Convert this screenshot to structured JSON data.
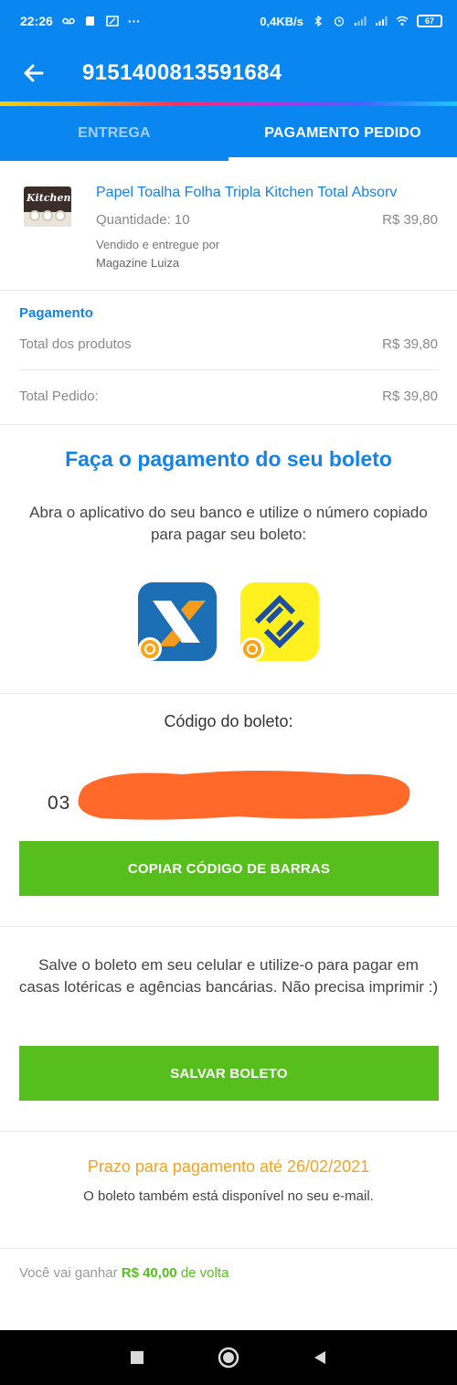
{
  "status_bar": {
    "time": "22:26",
    "extra": "···",
    "network_speed": "0,4KB/s",
    "battery": "67"
  },
  "app_bar": {
    "title": "9151400813591684",
    "back_icon": "arrow-left-icon"
  },
  "tabs": [
    {
      "label": "ENTREGA",
      "active": false
    },
    {
      "label": "PAGAMENTO PEDIDO",
      "active": true
    }
  ],
  "product": {
    "thumb_text": "Kitchen",
    "name": "Papel Toalha Folha Tripla Kitchen Total Absorv",
    "quantity": "Quantidade: 10",
    "price": "R$ 39,80",
    "sold_by": "Vendido e entregue por",
    "seller": "Magazine Luiza"
  },
  "payment": {
    "title": "Pagamento",
    "rows": [
      {
        "label": "Total dos produtos",
        "value": "R$ 39,80"
      },
      {
        "label": "Total Pedido:",
        "value": "R$ 39,80"
      }
    ]
  },
  "boleto": {
    "title": "Faça o pagamento do seu boleto",
    "instructions": "Abra o aplicativo do seu banco e utilize o número copiado para pagar seu boleto:",
    "banks": [
      "caixa-app-icon",
      "banco-do-brasil-app-icon"
    ]
  },
  "codigo": {
    "label": "Código do boleto:",
    "value_visible": "03",
    "copy_button": "COPIAR CÓDIGO DE BARRAS"
  },
  "salvar": {
    "text": "Salve o boleto em seu celular e utilize-o para pagar em casas lotéricas e agências bancárias. Não precisa imprimir :)",
    "button": "SALVAR BOLETO"
  },
  "prazo": {
    "title": "Prazo para pagamento até 26/02/2021",
    "text": "O boleto também está disponível no seu e-mail."
  },
  "cashback": {
    "prefix": "Você vai ganhar",
    "amount": "R$ 40,00",
    "suffix": "de volta"
  },
  "colors": {
    "primary": "#0a86f1",
    "link_blue": "#1582e6",
    "green": "#56bf1e",
    "orange": "#f2a323",
    "redaction": "#ff6a2b"
  }
}
